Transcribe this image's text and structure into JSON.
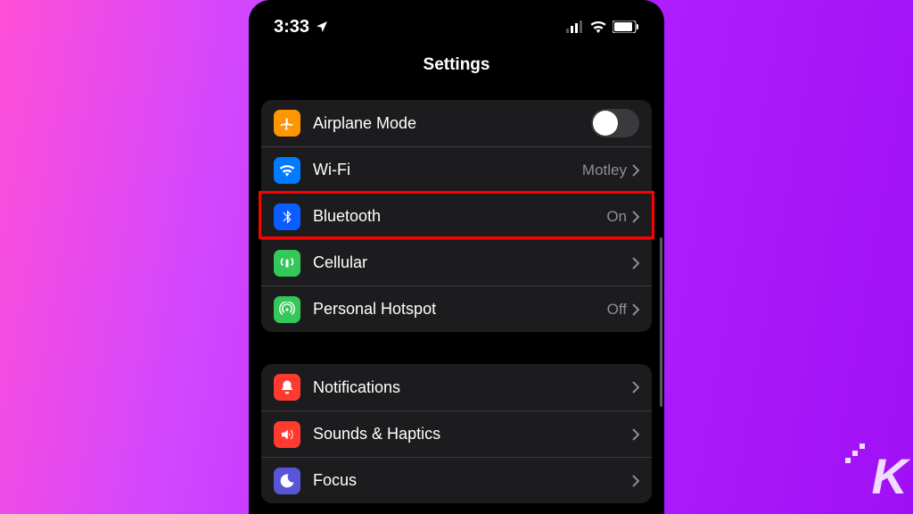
{
  "statusbar": {
    "time": "3:33"
  },
  "title": "Settings",
  "groups": [
    {
      "rows": [
        {
          "icon": "airplane-icon",
          "label": "Airplane Mode",
          "type": "toggle",
          "toggle": false,
          "color": "bg-orange"
        },
        {
          "icon": "wifi-icon",
          "label": "Wi-Fi",
          "type": "link",
          "value": "Motley",
          "color": "bg-blue"
        },
        {
          "icon": "bluetooth-icon",
          "label": "Bluetooth",
          "type": "link",
          "value": "On",
          "color": "bg-blue2",
          "highlighted": true
        },
        {
          "icon": "cellular-icon",
          "label": "Cellular",
          "type": "link",
          "value": "",
          "color": "bg-green"
        },
        {
          "icon": "hotspot-icon",
          "label": "Personal Hotspot",
          "type": "link",
          "value": "Off",
          "color": "bg-green2"
        }
      ]
    },
    {
      "rows": [
        {
          "icon": "bell-icon",
          "label": "Notifications",
          "type": "link",
          "value": "",
          "color": "bg-red"
        },
        {
          "icon": "speaker-icon",
          "label": "Sounds & Haptics",
          "type": "link",
          "value": "",
          "color": "bg-red"
        },
        {
          "icon": "moon-icon",
          "label": "Focus",
          "type": "link",
          "value": "",
          "color": "bg-indigo"
        }
      ]
    }
  ],
  "watermark": "K"
}
